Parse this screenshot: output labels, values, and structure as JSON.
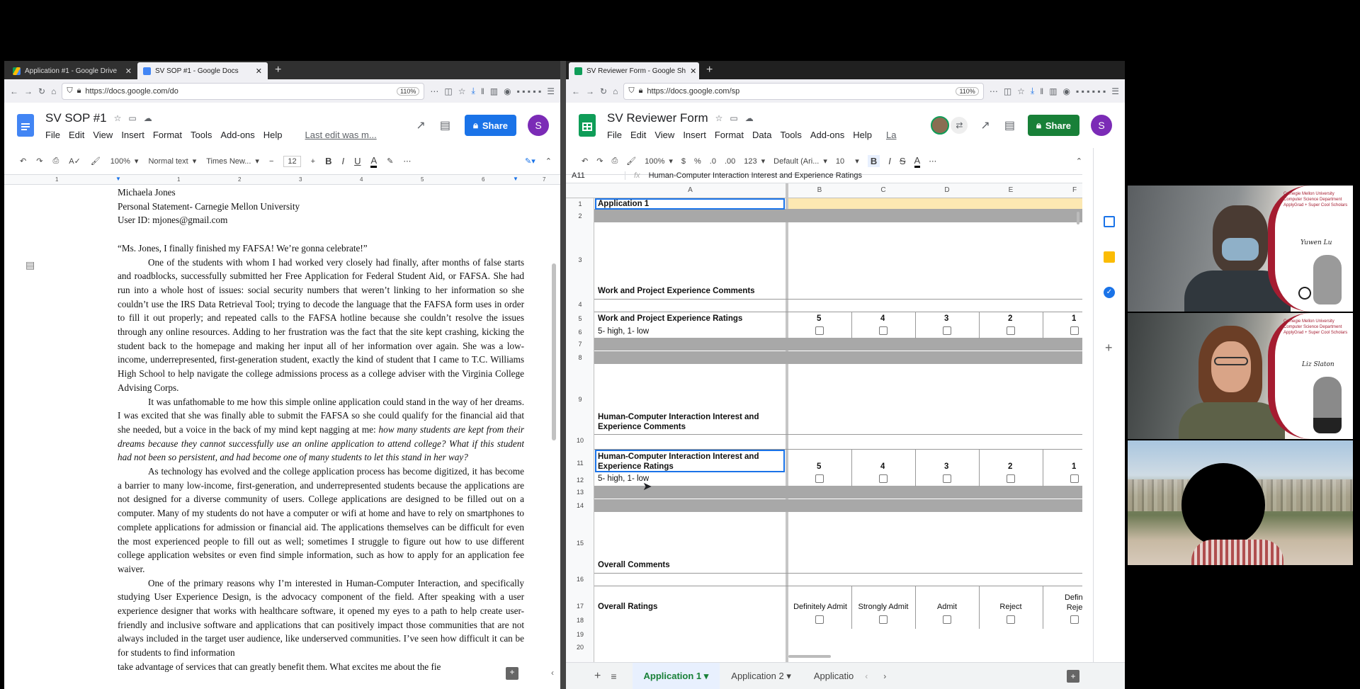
{
  "left_window": {
    "tabs": [
      {
        "label": "Application #1 - Google Drive",
        "close": "✕"
      },
      {
        "label": "SV SOP #1 - Google Docs",
        "close": "✕"
      }
    ],
    "new_tab": "+",
    "url": "https://docs.google.com/do",
    "zoom": "110%",
    "doc_title": "SV SOP #1",
    "menus": [
      "File",
      "Edit",
      "View",
      "Insert",
      "Format",
      "Tools",
      "Add-ons",
      "Help"
    ],
    "last_edit": "Last edit was m...",
    "share_label": "Share",
    "avatar_letter": "S",
    "toolbar": {
      "zoom": "100%",
      "style": "Normal text",
      "font": "Times New...",
      "size": "12",
      "bold": "B",
      "italic": "I",
      "underline": "U",
      "color": "A"
    },
    "ruler": [
      "1",
      "1",
      "2",
      "3",
      "4",
      "5",
      "6",
      "7"
    ],
    "header_lines": [
      "Michaela Jones",
      "Personal Statement- Carnegie Mellon University",
      "User ID: mjones@gmail.com"
    ],
    "quote": "“Ms. Jones, I finally finished my FAFSA! We’re gonna celebrate!”",
    "para1": "One of the students with whom I had worked very closely had finally, after months of false starts and roadblocks, successfully submitted her Free Application for Federal Student Aid, or FAFSA. She had run into a whole host of issues: social security numbers that weren’t linking to her information so she couldn’t use the IRS Data Retrieval Tool; trying to decode the language that the FAFSA form uses in order to fill it out properly; and repeated calls to the FAFSA hotline because she couldn’t resolve the issues through any online resources. Adding to her frustration was the fact that the site kept crashing, kicking the student back to the homepage and making her input all of her information over again. She was a low-income, underrepresented, first-generation student, exactly the kind of student that I came to T.C. Williams High School to help navigate the college admissions process as a college adviser with the Virginia College Advising Corps.",
    "para2_a": "It was unfathomable to me how this simple online application could stand in the way of her dreams. I was excited that she was finally able to submit the FAFSA so she could qualify for the financial aid that she needed, but a voice in the back of my mind kept nagging at me: ",
    "para2_b": "how many students are kept from their dreams because they cannot successfully use an online application to attend college? What if this student had not been so persistent, and had become one of many students to let this stand in her way?",
    "para3": "As technology has evolved and the college application process has become digitized, it has become a barrier to many low-income, first-generation, and underrepresented students because the applications are not designed for a diverse community of users. College applications are designed to be filled out on a computer. Many of my students do not have a computer or wifi at home and have to rely on smartphones to complete applications for admission or financial aid. The applications themselves can be difficult for even the most experienced people to fill out as well; sometimes I struggle to figure out how to use different college application websites or even find simple information, such as how to apply for an application fee waiver.",
    "para4": "One of the primary reasons why I’m interested in Human-Computer Interaction, and specifically studying User Experience Design, is the advocacy component of the field. After speaking with a user experience designer that works with healthcare software, it opened my eyes to a path to help create user-friendly and inclusive software and applications that can positively impact those communities that are not always included in the target user audience, like underserved communities. I’ve seen how difficult it can be for students to find information",
    "para4_cut": "take advantage of services that can greatly benefit them. What excites me about the fie"
  },
  "right_window": {
    "tab_label": "SV Reviewer Form - Google Sh",
    "tab_close": "✕",
    "new_tab": "+",
    "url": "https://docs.google.com/sp",
    "zoom": "110%",
    "doc_title": "SV Reviewer Form",
    "menus": [
      "File",
      "Edit",
      "View",
      "Insert",
      "Format",
      "Data",
      "Tools",
      "Add-ons",
      "Help",
      "La"
    ],
    "share_label": "Share",
    "avatar_letter": "S",
    "toolbar": {
      "zoom": "100%",
      "currency": "$",
      "percent": "%",
      "dec_less": ".0",
      "dec_more": ".00",
      "format": "123",
      "font": "Default (Ari...",
      "size": "10",
      "bold": "B",
      "italic": "I",
      "strike": "S",
      "color": "A"
    },
    "cell_ref": "A11",
    "fx": "fx",
    "formula": "Human-Computer Interaction Interest and Experience Ratings",
    "columns": [
      "A",
      "B",
      "C",
      "D",
      "E",
      "F"
    ],
    "rows": [
      "1",
      "2",
      "3",
      "4",
      "5",
      "6",
      "7",
      "8",
      "9",
      "10",
      "11",
      "12",
      "13",
      "14",
      "15",
      "16",
      "17",
      "18",
      "19",
      "20"
    ],
    "cells": {
      "a1": "Application 1",
      "a3": "Work and Project Experience Comments",
      "a5": "Work and Project Experience Ratings",
      "a6": "5- high, 1- low",
      "a9": "Human-Computer Interaction Interest and Experience Comments",
      "a11": "Human-Computer Interaction Interest and Experience Ratings",
      "a12": "5- high, 1- low",
      "a15": "Overall Comments",
      "a17": "Overall Ratings"
    },
    "ratings": [
      "5",
      "4",
      "3",
      "2",
      "1"
    ],
    "overall_options": [
      "Definitely Admit",
      "Strongly Admit",
      "Admit",
      "Reject",
      "Defini Reje"
    ],
    "sheet_tabs": [
      "Application 1",
      "Application 2",
      "Applicatio"
    ],
    "add_sheet": "+",
    "all_sheets": "≡"
  },
  "video": {
    "tile1": {
      "org": "Carnegie Mellon University",
      "dept": "Computer Science Department",
      "program": "ApplyGrad + Super Cool Scholars",
      "name": "Yuwen Lu"
    },
    "tile2": {
      "org": "Carnegie Mellon University",
      "dept": "Computer Science Department",
      "program": "ApplyGrad + Super Cool Scholars",
      "name": "Liz Slaton"
    }
  }
}
